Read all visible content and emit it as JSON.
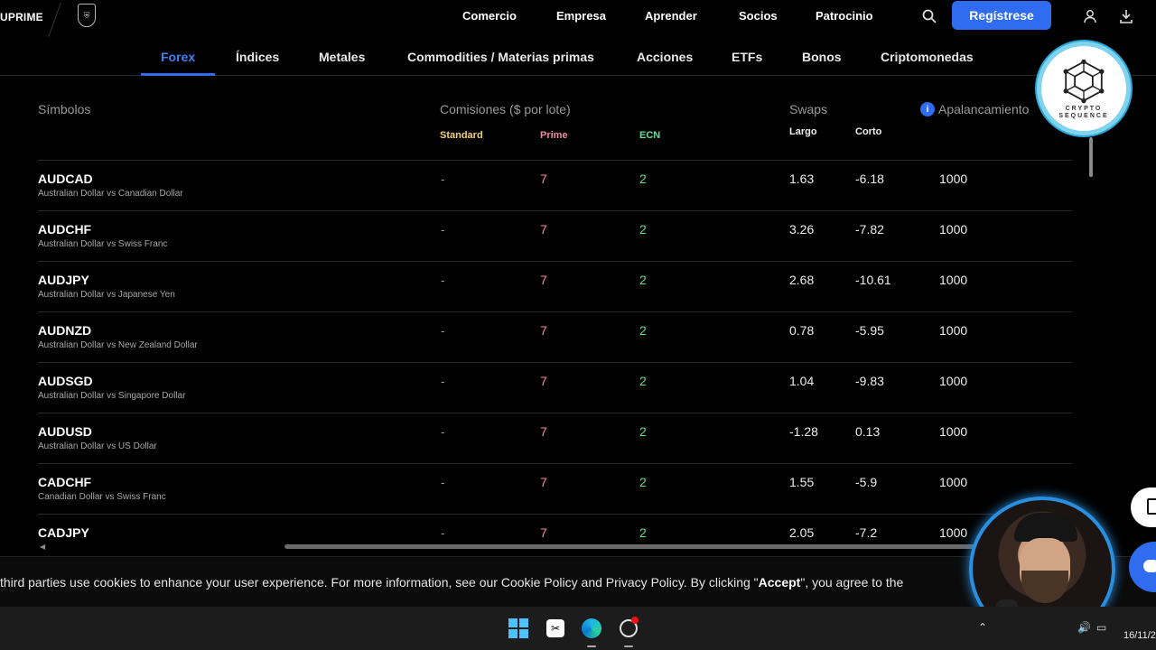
{
  "nav": {
    "brand": "UPRIME",
    "links": [
      "Comercio",
      "Empresa",
      "Aprender",
      "Socios",
      "Patrocinio"
    ],
    "register_label": "Regístrese"
  },
  "tabs": [
    "Forex",
    "Índices",
    "Metales",
    "Commodities / Materias primas",
    "Acciones",
    "ETFs",
    "Bonos",
    "Criptomonedas"
  ],
  "active_tab": "Forex",
  "table": {
    "headers": {
      "symbols": "Símbolos",
      "commissions": "Comisiones ($ por lote)",
      "swaps": "Swaps",
      "leverage": "Apalancamiento"
    },
    "subheaders": {
      "standard": "Standard",
      "prime": "Prime",
      "ecn": "ECN",
      "largo": "Largo",
      "corto": "Corto"
    },
    "rows": [
      {
        "symbol": "AUDCAD",
        "desc": "Australian Dollar vs Canadian Dollar",
        "standard": "-",
        "prime": "7",
        "ecn": "2",
        "largo": "1.63",
        "corto": "-6.18",
        "leverage": "1000"
      },
      {
        "symbol": "AUDCHF",
        "desc": "Australian Dollar vs Swiss Franc",
        "standard": "-",
        "prime": "7",
        "ecn": "2",
        "largo": "3.26",
        "corto": "-7.82",
        "leverage": "1000"
      },
      {
        "symbol": "AUDJPY",
        "desc": "Australian Dollar vs Japanese Yen",
        "standard": "-",
        "prime": "7",
        "ecn": "2",
        "largo": "2.68",
        "corto": "-10.61",
        "leverage": "1000"
      },
      {
        "symbol": "AUDNZD",
        "desc": "Australian Dollar vs New Zealand Dollar",
        "standard": "-",
        "prime": "7",
        "ecn": "2",
        "largo": "0.78",
        "corto": "-5.95",
        "leverage": "1000"
      },
      {
        "symbol": "AUDSGD",
        "desc": "Australian Dollar vs Singapore Dollar",
        "standard": "-",
        "prime": "7",
        "ecn": "2",
        "largo": "1.04",
        "corto": "-9.83",
        "leverage": "1000"
      },
      {
        "symbol": "AUDUSD",
        "desc": "Australian Dollar vs US Dollar",
        "standard": "-",
        "prime": "7",
        "ecn": "2",
        "largo": "-1.28",
        "corto": "0.13",
        "leverage": "1000"
      },
      {
        "symbol": "CADCHF",
        "desc": "Canadian Dollar vs Swiss Franc",
        "standard": "-",
        "prime": "7",
        "ecn": "2",
        "largo": "1.55",
        "corto": "-5.9",
        "leverage": "1000"
      },
      {
        "symbol": "CADJPY",
        "desc": "",
        "standard": "-",
        "prime": "7",
        "ecn": "2",
        "largo": "2.05",
        "corto": "-7.2",
        "leverage": "1000"
      }
    ]
  },
  "cookie": {
    "text_1": " third parties use cookies to enhance your user experience. For more information, see our Cookie Policy and Privacy Policy. By clicking \"",
    "accept": "Accept",
    "text_2": "\", you agree to the"
  },
  "overlay_logo": {
    "line1": "CRYPTO",
    "line2": "SEQUENCE"
  },
  "taskbar": {
    "clock": "16/11/2"
  },
  "colors": {
    "accent": "#2f6cf0",
    "prime": "#f08aa3",
    "ecn": "#5fe0a0",
    "standard": "#f5d36b"
  }
}
